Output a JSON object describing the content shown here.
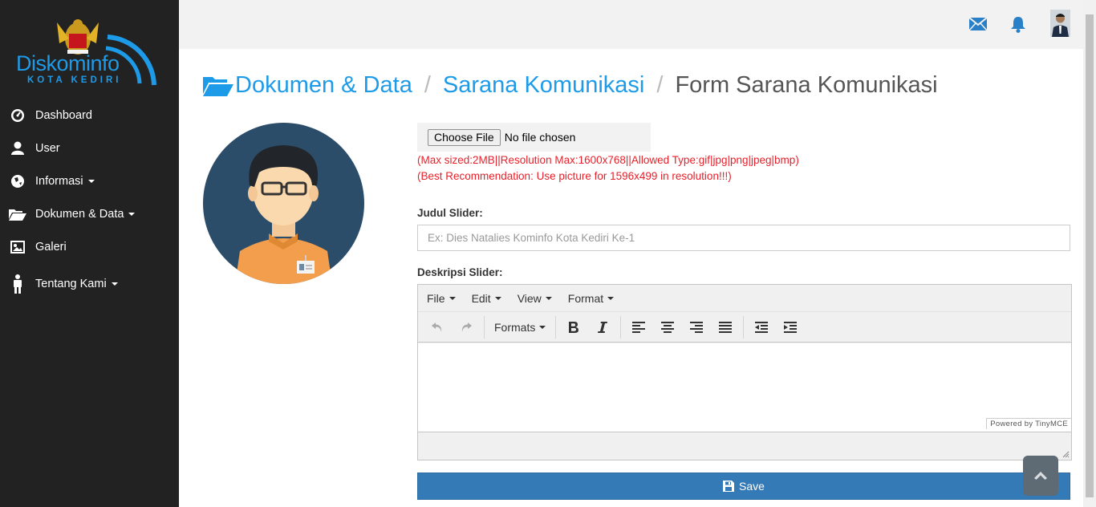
{
  "brand": {
    "name": "Diskominfo",
    "subtitle": "KOTA KEDIRI"
  },
  "sidebar": {
    "items": [
      {
        "label": "Dashboard",
        "icon": "dashboard-icon",
        "has_caret": false
      },
      {
        "label": "User",
        "icon": "user-icon",
        "has_caret": false
      },
      {
        "label": "Informasi",
        "icon": "globe-icon",
        "has_caret": true
      },
      {
        "label": "Dokumen & Data",
        "icon": "folder-open-icon",
        "has_caret": true
      },
      {
        "label": "Galeri",
        "icon": "picture-icon",
        "has_caret": false
      },
      {
        "label": "Tentang Kami",
        "icon": "person-icon",
        "has_caret": true
      }
    ]
  },
  "topbar": {
    "icons": [
      "envelope-icon",
      "bell-icon",
      "user-avatar"
    ]
  },
  "breadcrumb": {
    "items": [
      "Dokumen & Data",
      "Sarana Komunikasi"
    ],
    "current": "Form Sarana Komunikasi",
    "separator": "/"
  },
  "form": {
    "file": {
      "button_label": "Choose File",
      "status": "No file chosen"
    },
    "notes": [
      "(Max sized:2MB||Resolution Max:1600x768||Allowed Type:gif|jpg|png|jpeg|bmp)",
      "(Best Recommendation: Use picture for 1596x499 in resolution!!!)"
    ],
    "title_label": "Judul Slider:",
    "title_placeholder": "Ex: Dies Natalies Kominfo Kota Kediri Ke-1",
    "title_value": "",
    "description_label": "Deskripsi Slider:",
    "save_label": "Save"
  },
  "editor": {
    "menus": [
      "File",
      "Edit",
      "View",
      "Format"
    ],
    "formats_label": "Formats",
    "powered_by": "Powered by TinyMCE",
    "content": ""
  },
  "colors": {
    "sidebar_bg": "#222222",
    "accent": "#1e9be8",
    "note_red": "#e8202a",
    "save_blue": "#337ab7"
  }
}
